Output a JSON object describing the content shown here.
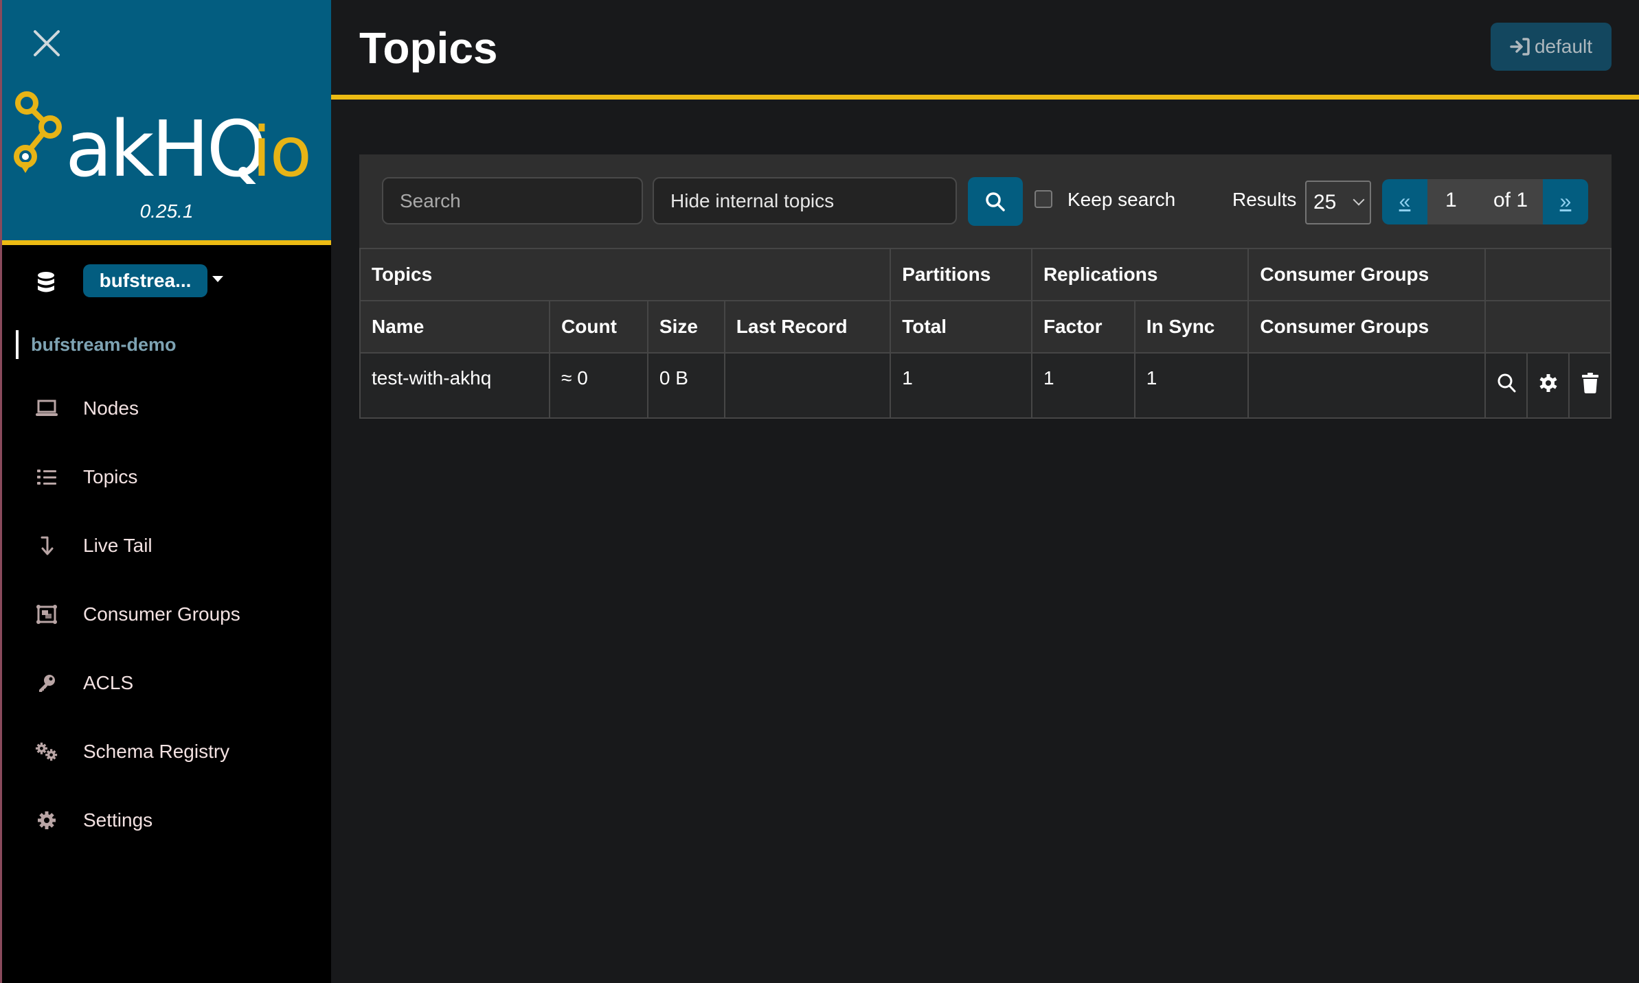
{
  "sidebar": {
    "version": "0.25.1",
    "logo_text": "akHQ.io",
    "cluster_selected": "bufstrea...",
    "cluster_name": "bufstream-demo",
    "items": [
      {
        "label": "Nodes",
        "icon": "laptop-icon"
      },
      {
        "label": "Topics",
        "icon": "list-icon"
      },
      {
        "label": "Live Tail",
        "icon": "level-down-arrow-icon"
      },
      {
        "label": "Consumer Groups",
        "icon": "object-group-icon"
      },
      {
        "label": "ACLS",
        "icon": "key-icon"
      },
      {
        "label": "Schema Registry",
        "icon": "cogs-icon"
      },
      {
        "label": "Settings",
        "icon": "gear-icon"
      }
    ]
  },
  "header": {
    "title": "Topics",
    "default_button": "default"
  },
  "toolbar": {
    "search_placeholder": "Search",
    "filter_value": "Hide internal topics",
    "keep_search_label": "Keep search",
    "keep_search_checked": false,
    "results_label": "Results",
    "results_value": "25",
    "pager": {
      "prev": "«",
      "current": "1",
      "of": "of 1",
      "next": "»"
    }
  },
  "table": {
    "group_headers": [
      "Topics",
      "Partitions",
      "Replications",
      "Consumer Groups",
      ""
    ],
    "columns": [
      "Name",
      "Count",
      "Size",
      "Last Record",
      "Total",
      "Factor",
      "In Sync",
      "Consumer Groups"
    ],
    "rows": [
      {
        "name": "test-with-akhq",
        "count": "≈ 0",
        "size": "0 B",
        "last_record": "",
        "total": "1",
        "factor": "1",
        "in_sync": "1",
        "consumer_groups": ""
      }
    ]
  },
  "colors": {
    "brand_blue": "#035d80",
    "accent_yellow": "#ecbb13",
    "background": "#18191b",
    "sidebar": "#000000"
  }
}
